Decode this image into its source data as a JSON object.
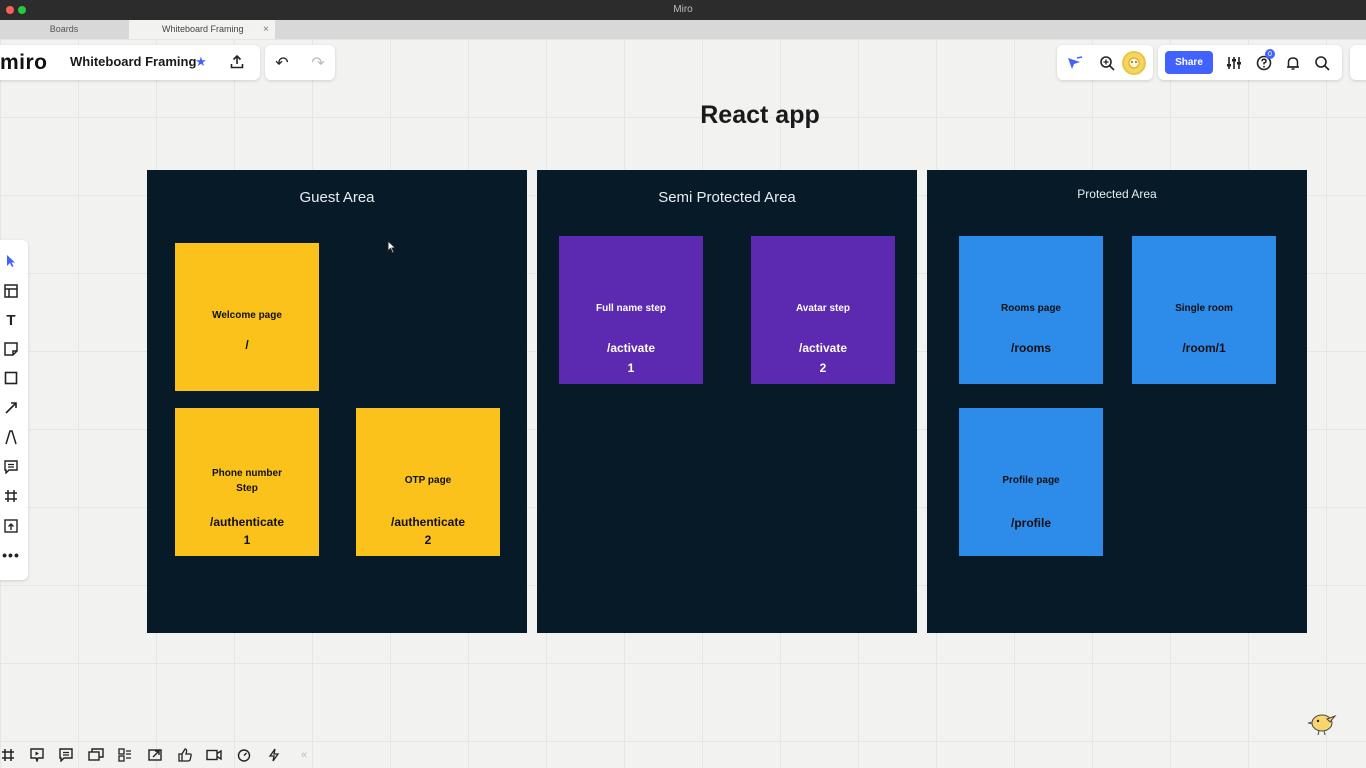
{
  "window": {
    "title": "Miro",
    "traffic_lights": [
      "#fe5f57",
      "#febc2e",
      "#28c840"
    ]
  },
  "tabs": [
    {
      "label": "Boards",
      "active": false
    },
    {
      "label": "Whiteboard Framing",
      "active": true,
      "close": "×"
    }
  ],
  "toolbar": {
    "logo": "miro",
    "board_title": "Whiteboard Framing",
    "star_icon": "★",
    "upload_icon": "⇪",
    "undo_icon": "↶",
    "redo_icon": "↷",
    "share_label": "Share",
    "help_badge": "0",
    "accent": "#4262ff"
  },
  "canvas": {
    "heading": "React app",
    "frames": [
      {
        "title": "Guest Area",
        "stickies": [
          {
            "line1": "Welcome page",
            "line2": "",
            "path": "/",
            "step": "",
            "color": "#fac21a"
          },
          {
            "line1": "Phone number",
            "line2": "Step",
            "path": "/authenticate",
            "step": "1",
            "color": "#fac21a"
          },
          {
            "line1": "OTP page",
            "line2": "",
            "path": "/authenticate",
            "step": "2",
            "color": "#fac21a"
          }
        ]
      },
      {
        "title": "Semi Protected Area",
        "stickies": [
          {
            "line1": "Full name step",
            "line2": "",
            "path": "/activate",
            "step": "1",
            "color": "#5b2ab0"
          },
          {
            "line1": "Avatar step",
            "line2": "",
            "path": "/activate",
            "step": "2",
            "color": "#5b2ab0"
          }
        ]
      },
      {
        "title": "Protected Area",
        "stickies": [
          {
            "line1": "Rooms page",
            "line2": "",
            "path": "/rooms",
            "step": "",
            "color": "#2d8bea"
          },
          {
            "line1": "Single room",
            "line2": "",
            "path": "/room/1",
            "step": "",
            "color": "#2d8bea"
          },
          {
            "line1": "Profile page",
            "line2": "",
            "path": "/profile",
            "step": "",
            "color": "#2d8bea"
          }
        ]
      }
    ],
    "frame_color": "#071a28"
  },
  "left_tools": [
    "select",
    "templates",
    "text",
    "sticky-note",
    "shape",
    "connection-line",
    "pen",
    "comment",
    "frame",
    "upload",
    "more"
  ],
  "bottom_tools": [
    "frames",
    "present",
    "comments",
    "cards",
    "kanban",
    "share-screen",
    "reactions",
    "video",
    "timer",
    "lightning",
    "collapse"
  ]
}
